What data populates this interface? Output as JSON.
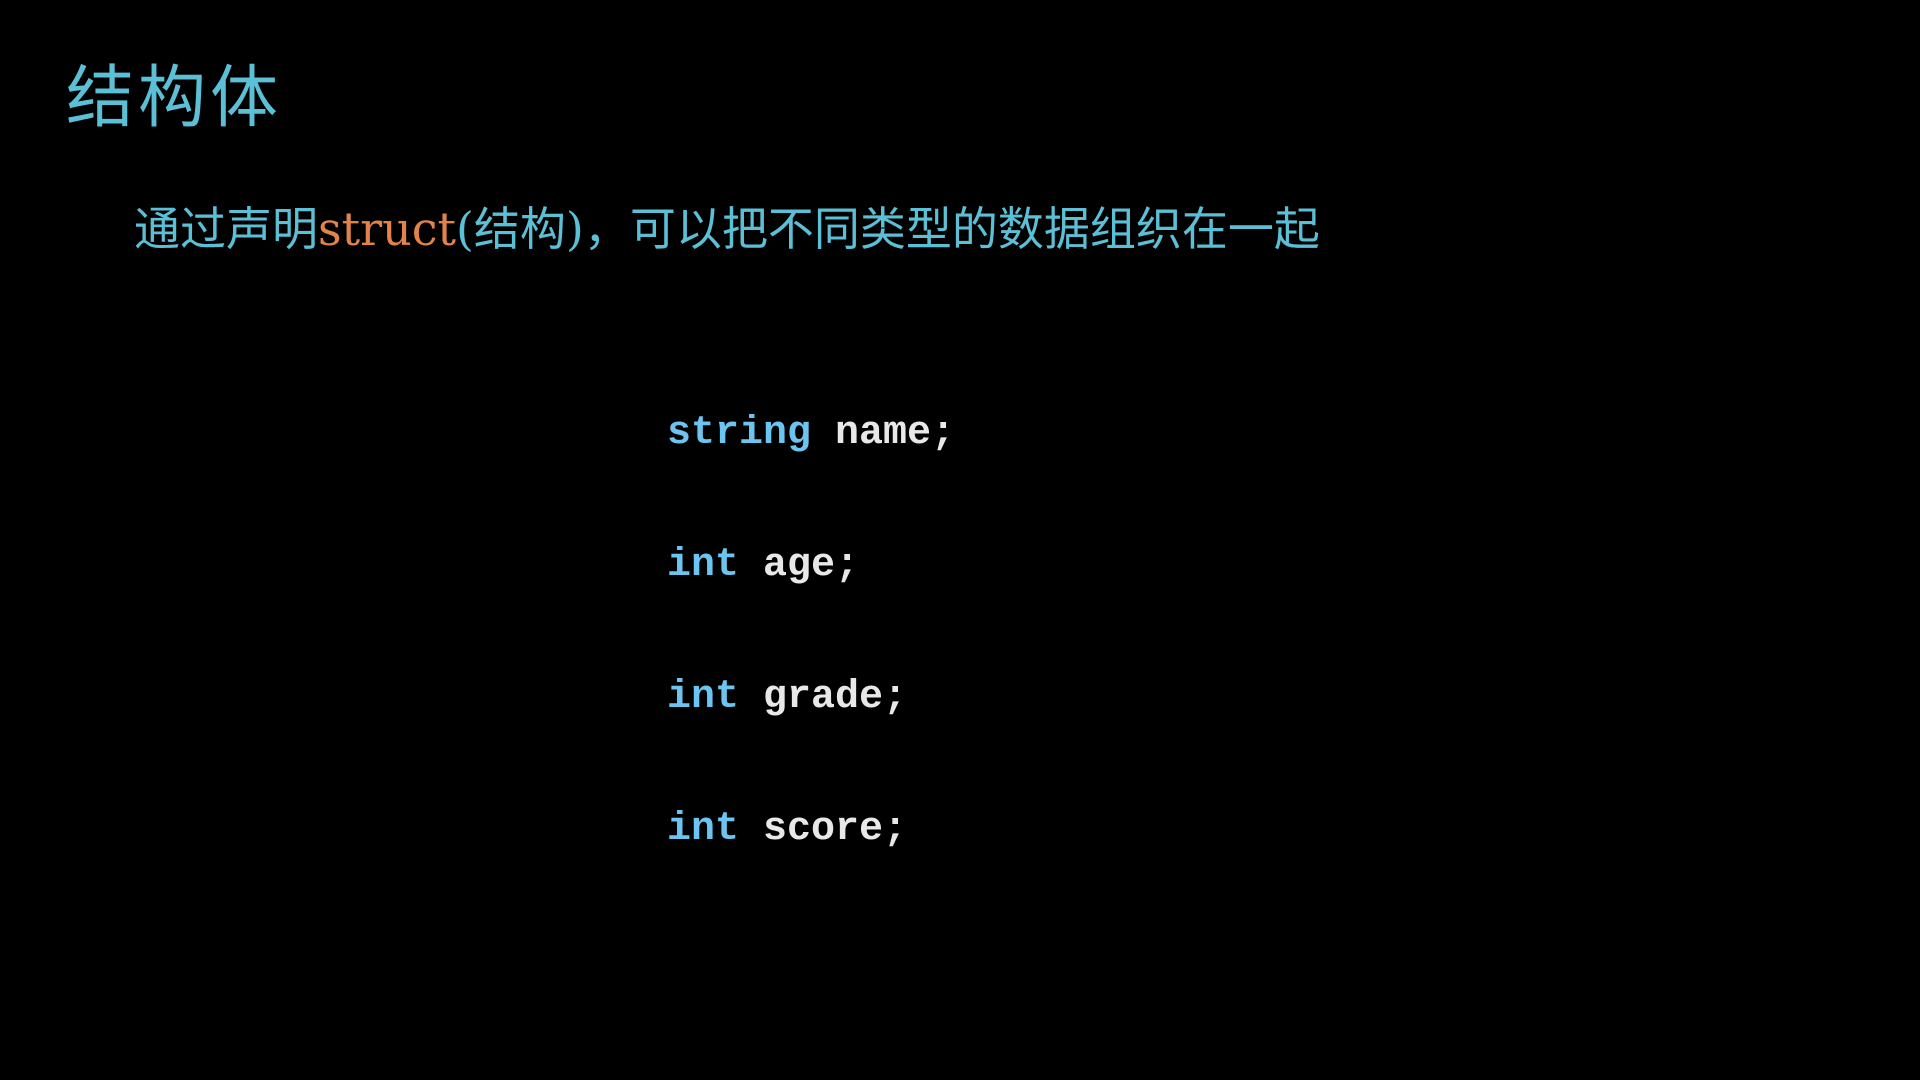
{
  "slide": {
    "title": "结构体",
    "subtitle": {
      "lead": "通过声明",
      "keyword": "struct",
      "trail": "(结构)，可以把不同类型的数据组织在一起"
    },
    "code": [
      {
        "type": "string",
        "rest": " name;"
      },
      {
        "type": "int",
        "rest": " age;"
      },
      {
        "type": "int",
        "rest": " grade;"
      },
      {
        "type": "int",
        "rest": " score;"
      }
    ]
  },
  "colors": {
    "background": "#000000",
    "title": "#5bbfd6",
    "subtitle": "#5bbfd6",
    "keyword_highlight": "#e2834a",
    "code_type": "#6cc4f0",
    "code_text": "#e8e8e8"
  }
}
